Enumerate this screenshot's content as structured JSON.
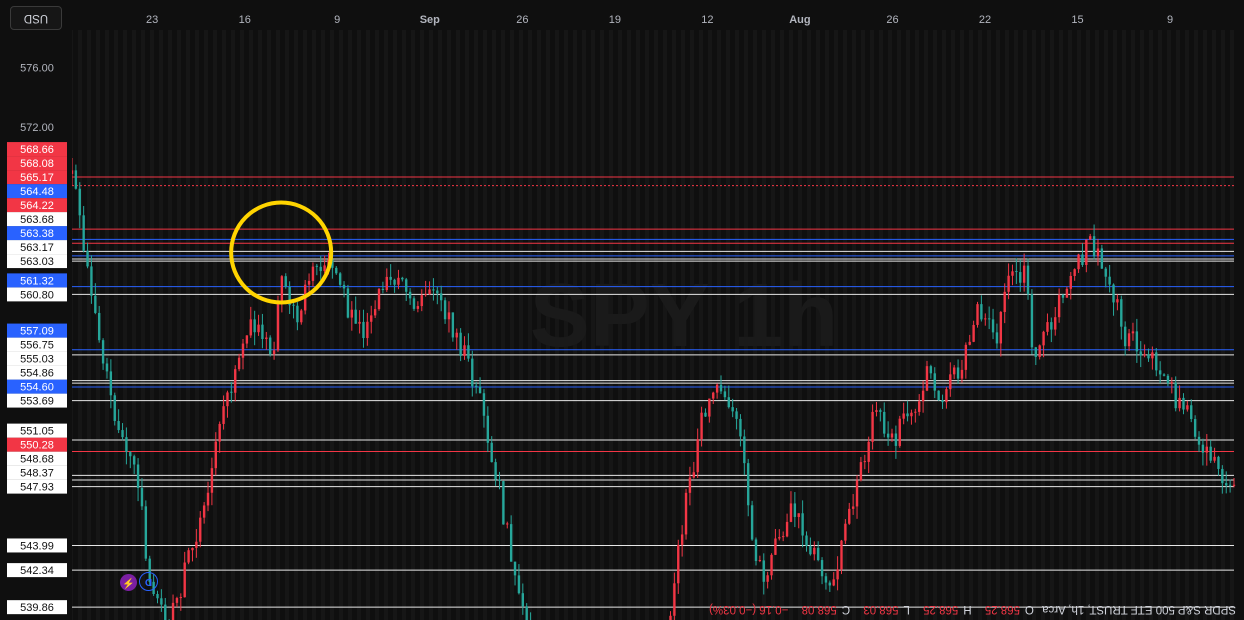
{
  "legend": {
    "symbol": "SPDR S&P 500 ETF TRUST, 1h, Arca",
    "open_label": "O",
    "open": "568.25",
    "high_label": "H",
    "high": "568.25",
    "low_label": "L",
    "low": "568.03",
    "close_label": "C",
    "close": "568.08",
    "change": "−0.16 (−0.03%)"
  },
  "currency_button": "USD",
  "badges": {
    "d": "D",
    "flash": "⚡"
  },
  "watermark": "SPY 1h",
  "colors": {
    "background": "#0f0f0f",
    "up": "#26a69a",
    "down": "#f23645",
    "blue_level": "#2962ff",
    "white_level": "#e6e6e6",
    "highlight_circle": "#ffd400"
  },
  "chart_data": {
    "type": "candlestick",
    "title": "SPDR S&P 500 ETF TRUST, 1h, Arca",
    "orientation": "rotated 180 degrees",
    "y_axis": {
      "ticks": [
        "572.00",
        "576.00"
      ],
      "range": [
        539.0,
        578.5
      ]
    },
    "x_axis": {
      "ticks": [
        "9",
        "15",
        "22",
        "26",
        "Aug",
        "12",
        "19",
        "26",
        "Sep",
        "9",
        "16",
        "23"
      ]
    },
    "horizontal_levels": [
      {
        "value": 539.86,
        "label": "539.86",
        "kind": "white"
      },
      {
        "value": 542.34,
        "label": "542.34",
        "kind": "white"
      },
      {
        "value": 543.99,
        "label": "543.99",
        "kind": "white"
      },
      {
        "value": 547.93,
        "label": "547.93",
        "kind": "white"
      },
      {
        "value": 548.37,
        "label": "548.37",
        "kind": "white"
      },
      {
        "value": 548.68,
        "label": "548.68",
        "kind": "white"
      },
      {
        "value": 550.28,
        "label": "550.28",
        "kind": "red"
      },
      {
        "value": 551.05,
        "label": "551.05",
        "kind": "white"
      },
      {
        "value": 553.69,
        "label": "553.69",
        "kind": "white"
      },
      {
        "value": 554.6,
        "label": "554.60",
        "kind": "blue"
      },
      {
        "value": 554.86,
        "label": "554.86",
        "kind": "white"
      },
      {
        "value": 555.03,
        "label": "555.03",
        "kind": "white"
      },
      {
        "value": 556.75,
        "label": "556.75",
        "kind": "white"
      },
      {
        "value": 557.09,
        "label": "557.09",
        "kind": "blue"
      },
      {
        "value": 560.8,
        "label": "560.80",
        "kind": "white"
      },
      {
        "value": 561.32,
        "label": "561.32",
        "kind": "blue"
      },
      {
        "value": 563.03,
        "label": "563.03",
        "kind": "white"
      },
      {
        "value": 563.17,
        "label": "563.17",
        "kind": "white"
      },
      {
        "value": 563.38,
        "label": "563.38",
        "kind": "blue"
      },
      {
        "value": 563.68,
        "label": "563.68",
        "kind": "white"
      },
      {
        "value": 564.22,
        "label": "564.22",
        "kind": "red"
      },
      {
        "value": 564.48,
        "label": "564.48",
        "kind": "blue"
      },
      {
        "value": 565.17,
        "label": "565.17",
        "kind": "red"
      },
      {
        "value": 568.08,
        "label": "568.08",
        "kind": "red"
      },
      {
        "value": 568.66,
        "label": "568.66",
        "kind": "red"
      }
    ],
    "price_path": [
      {
        "t": 0.0,
        "p": 548.0
      },
      {
        "t": 0.02,
        "p": 550.5
      },
      {
        "t": 0.04,
        "p": 553.0
      },
      {
        "t": 0.06,
        "p": 555.5
      },
      {
        "t": 0.075,
        "p": 557.0
      },
      {
        "t": 0.09,
        "p": 558.0
      },
      {
        "t": 0.1,
        "p": 561.0
      },
      {
        "t": 0.11,
        "p": 562.5
      },
      {
        "t": 0.12,
        "p": 564.5
      },
      {
        "t": 0.13,
        "p": 563.0
      },
      {
        "t": 0.145,
        "p": 561.0
      },
      {
        "t": 0.16,
        "p": 558.0
      },
      {
        "t": 0.17,
        "p": 557.0
      },
      {
        "t": 0.175,
        "p": 562.0
      },
      {
        "t": 0.19,
        "p": 562.5
      },
      {
        "t": 0.2,
        "p": 557.5
      },
      {
        "t": 0.215,
        "p": 560.0
      },
      {
        "t": 0.23,
        "p": 556.0
      },
      {
        "t": 0.25,
        "p": 554.0
      },
      {
        "t": 0.26,
        "p": 555.5
      },
      {
        "t": 0.275,
        "p": 553.0
      },
      {
        "t": 0.29,
        "p": 551.0
      },
      {
        "t": 0.305,
        "p": 553.0
      },
      {
        "t": 0.315,
        "p": 550.0
      },
      {
        "t": 0.325,
        "p": 547.0
      },
      {
        "t": 0.335,
        "p": 543.5
      },
      {
        "t": 0.345,
        "p": 541.0
      },
      {
        "t": 0.36,
        "p": 544.0
      },
      {
        "t": 0.375,
        "p": 546.5
      },
      {
        "t": 0.39,
        "p": 544.0
      },
      {
        "t": 0.4,
        "p": 542.0
      },
      {
        "t": 0.41,
        "p": 544.0
      },
      {
        "t": 0.42,
        "p": 551.0
      },
      {
        "t": 0.43,
        "p": 553.5
      },
      {
        "t": 0.44,
        "p": 554.5
      },
      {
        "t": 0.455,
        "p": 552.5
      },
      {
        "t": 0.47,
        "p": 546.0
      },
      {
        "t": 0.485,
        "p": 538.0
      },
      {
        "t": 0.6,
        "p": 538.0
      },
      {
        "t": 0.615,
        "p": 542.0
      },
      {
        "t": 0.625,
        "p": 546.0
      },
      {
        "t": 0.64,
        "p": 552.0
      },
      {
        "t": 0.655,
        "p": 556.0
      },
      {
        "t": 0.67,
        "p": 558.5
      },
      {
        "t": 0.685,
        "p": 561.0
      },
      {
        "t": 0.7,
        "p": 560.0
      },
      {
        "t": 0.715,
        "p": 562.5
      },
      {
        "t": 0.73,
        "p": 561.0
      },
      {
        "t": 0.745,
        "p": 558.0
      },
      {
        "t": 0.76,
        "p": 560.0
      },
      {
        "t": 0.775,
        "p": 562.5
      },
      {
        "t": 0.79,
        "p": 563.5
      },
      {
        "t": 0.8,
        "p": 559.0
      },
      {
        "t": 0.815,
        "p": 562.0
      },
      {
        "t": 0.825,
        "p": 556.5
      },
      {
        "t": 0.84,
        "p": 559.0
      },
      {
        "t": 0.855,
        "p": 556.0
      },
      {
        "t": 0.87,
        "p": 552.0
      },
      {
        "t": 0.885,
        "p": 546.0
      },
      {
        "t": 0.9,
        "p": 542.0
      },
      {
        "t": 0.915,
        "p": 538.5
      },
      {
        "t": 0.93,
        "p": 542.0
      },
      {
        "t": 0.94,
        "p": 548.0
      },
      {
        "t": 0.95,
        "p": 550.0
      },
      {
        "t": 0.96,
        "p": 553.0
      },
      {
        "t": 0.97,
        "p": 557.0
      },
      {
        "t": 0.98,
        "p": 560.5
      },
      {
        "t": 0.99,
        "p": 566.5
      },
      {
        "t": 1.0,
        "p": 569.5
      }
    ],
    "annotation": "yellow circle highlighting a price swing around the 563–564 level"
  }
}
